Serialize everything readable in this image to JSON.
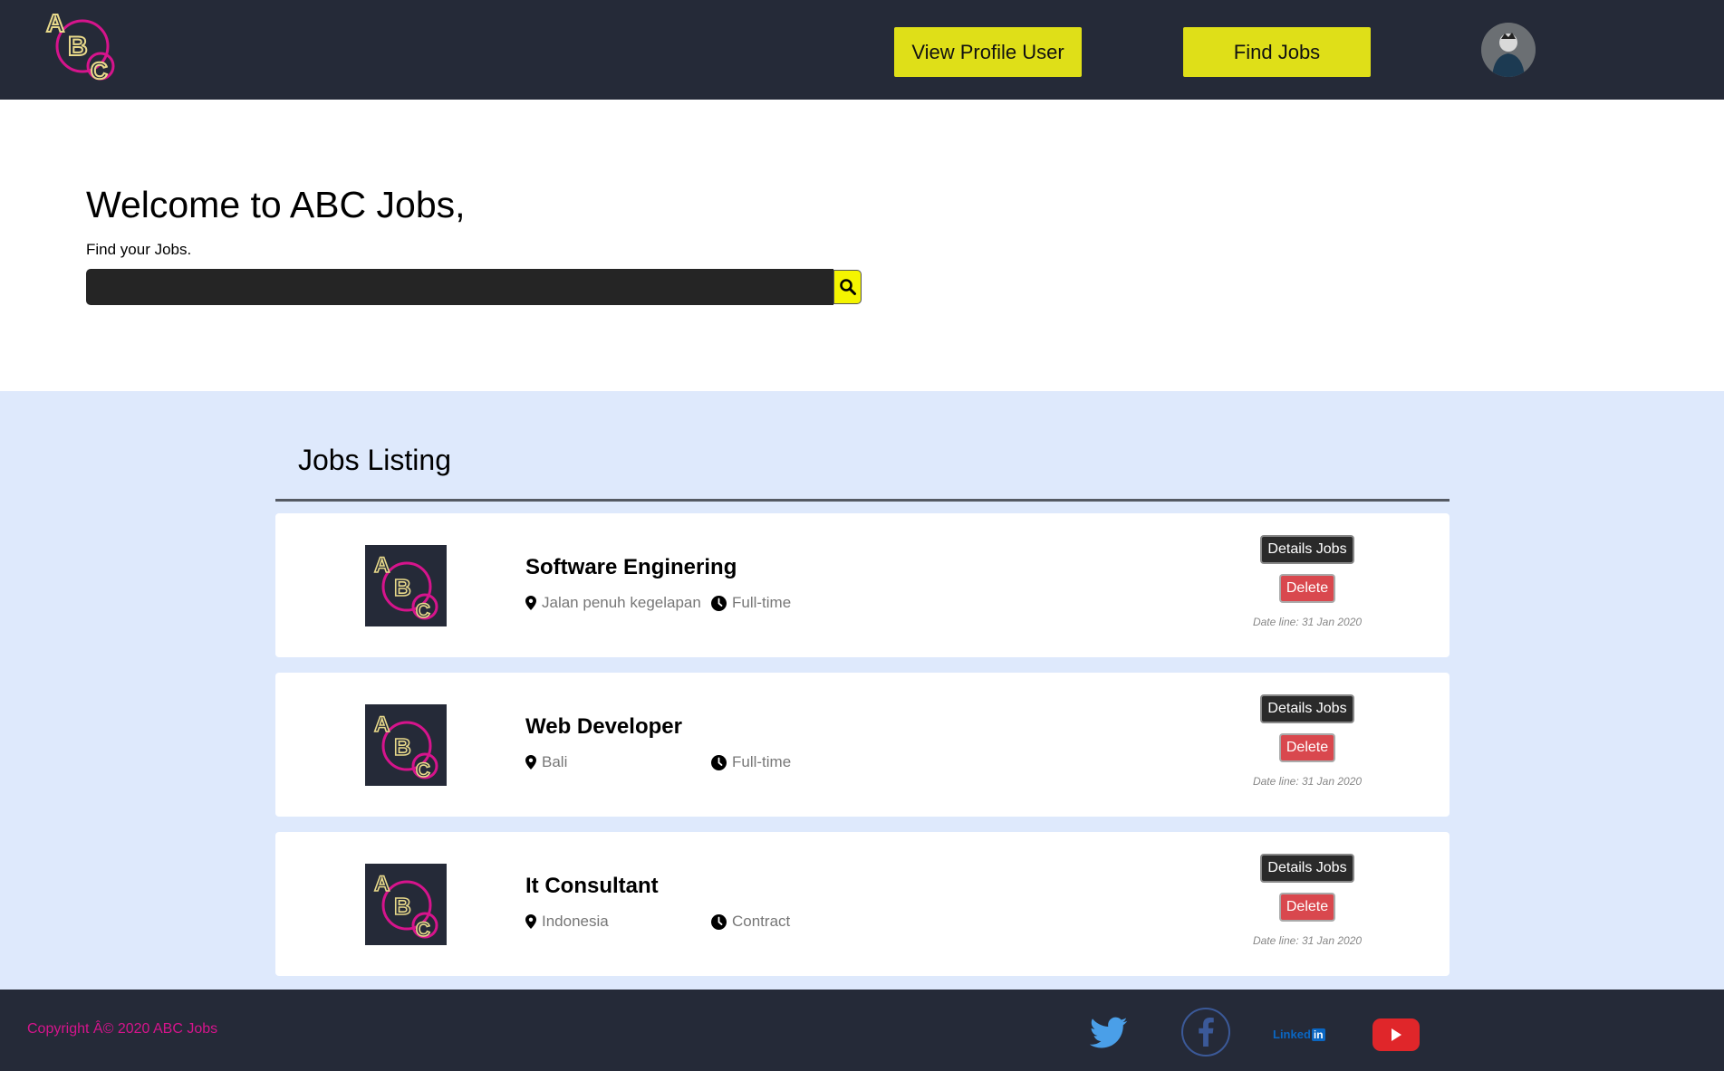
{
  "header": {
    "logo_letters": [
      "A",
      "B",
      "C"
    ],
    "view_profile_label": "View Profile User",
    "find_jobs_label": "Find Jobs",
    "avatar_icon": "user-avatar",
    "brand_yellow": "#dfdf18",
    "brand_dark": "#252a38"
  },
  "hero": {
    "title": "Welcome to ABC Jobs,",
    "subtitle": "Find your Jobs.",
    "search_value": "",
    "search_icon": "search-icon"
  },
  "listing": {
    "title": "Jobs Listing",
    "background": "#dee9fc",
    "jobs": [
      {
        "title": "Software Enginering",
        "location": "Jalan penuh kegelapan",
        "type": "Full-time",
        "details_label": "Details Jobs",
        "delete_label": "Delete",
        "deadline": "Date line: 31 Jan 2020"
      },
      {
        "title": "Web Developer",
        "location": "Bali",
        "type": "Full-time",
        "details_label": "Details Jobs",
        "delete_label": "Delete",
        "deadline": "Date line: 31 Jan 2020"
      },
      {
        "title": "It Consultant",
        "location": "Indonesia",
        "type": "Contract",
        "details_label": "Details Jobs",
        "delete_label": "Delete",
        "deadline": "Date line: 31 Jan 2020"
      }
    ]
  },
  "footer": {
    "copyright": "Copyright Â© 2020 ABC Jobs",
    "copyright_color": "#d6148c",
    "linkedin_text": "Linked",
    "linkedin_badge": "in",
    "social_icons": [
      "twitter-icon",
      "facebook-icon",
      "linkedin-icon",
      "youtube-icon"
    ]
  }
}
